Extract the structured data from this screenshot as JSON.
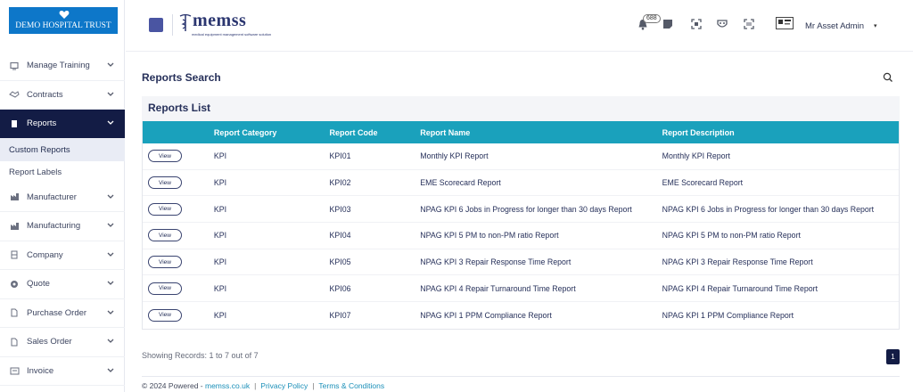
{
  "brand": {
    "name": "DEMO HOSPITAL TRUST"
  },
  "logo": {
    "text": "memss",
    "tagline": "medical equipment management software solution"
  },
  "sidebar": {
    "items": [
      {
        "label": "Manage Training",
        "icon": "monitor-icon"
      },
      {
        "label": "Contracts",
        "icon": "handshake-icon"
      },
      {
        "label": "Reports",
        "icon": "document-icon",
        "active": true
      },
      {
        "label": "Manufacturer",
        "icon": "factory-icon"
      },
      {
        "label": "Manufacturing",
        "icon": "factory-icon"
      },
      {
        "label": "Company",
        "icon": "building-icon"
      },
      {
        "label": "Quote",
        "icon": "quote-icon"
      },
      {
        "label": "Purchase Order",
        "icon": "file-icon"
      },
      {
        "label": "Sales Order",
        "icon": "file-icon"
      },
      {
        "label": "Invoice",
        "icon": "invoice-icon"
      }
    ],
    "sub_items": [
      {
        "label": "Custom Reports",
        "active": true
      },
      {
        "label": "Report Labels"
      }
    ]
  },
  "topbar": {
    "notification_count": "688",
    "user_name": "Mr Asset Admin",
    "caret": "▾"
  },
  "main": {
    "page_title": "Reports Search",
    "list_title": "Reports List",
    "columns": [
      "",
      "Report Category",
      "Report Code",
      "Report Name",
      "Report Description"
    ],
    "view_label": "View",
    "rows": [
      {
        "category": "KPI",
        "code": "KPI01",
        "name": "Monthly KPI Report",
        "description": "Monthly KPI Report"
      },
      {
        "category": "KPI",
        "code": "KPI02",
        "name": "EME Scorecard Report",
        "description": "EME Scorecard Report"
      },
      {
        "category": "KPI",
        "code": "KPI03",
        "name": "NPAG KPI 6 Jobs in Progress for longer than 30 days Report",
        "description": "NPAG KPI 6 Jobs in Progress for longer than 30 days Report"
      },
      {
        "category": "KPI",
        "code": "KPI04",
        "name": "NPAG KPI 5 PM to non-PM ratio Report",
        "description": "NPAG KPI 5 PM to non-PM ratio Report"
      },
      {
        "category": "KPI",
        "code": "KPI05",
        "name": "NPAG KPI 3 Repair Response Time Report",
        "description": "NPAG KPI 3 Repair Response Time Report"
      },
      {
        "category": "KPI",
        "code": "KPI06",
        "name": "NPAG KPI 4 Repair Turnaround Time Report",
        "description": "NPAG KPI 4 Repair Turnaround Time Report"
      },
      {
        "category": "KPI",
        "code": "KPI07",
        "name": "NPAG KPI 1 PPM Compliance Report",
        "description": "NPAG KPI 1 PPM Compliance Report"
      }
    ],
    "records_text": "Showing Records: 1 to 7 out of 7",
    "current_page": "1"
  },
  "footer": {
    "copyright": "© 2024 Powered - ",
    "site_link": "memss.co.uk",
    "privacy": "Privacy Policy",
    "terms": "Terms & Conditions",
    "separator": "|"
  },
  "colors": {
    "sidebar_active": "#131c45",
    "table_header": "#1aa1bc",
    "brand_bg": "#0d77c9",
    "accent": "#4a55a2"
  }
}
